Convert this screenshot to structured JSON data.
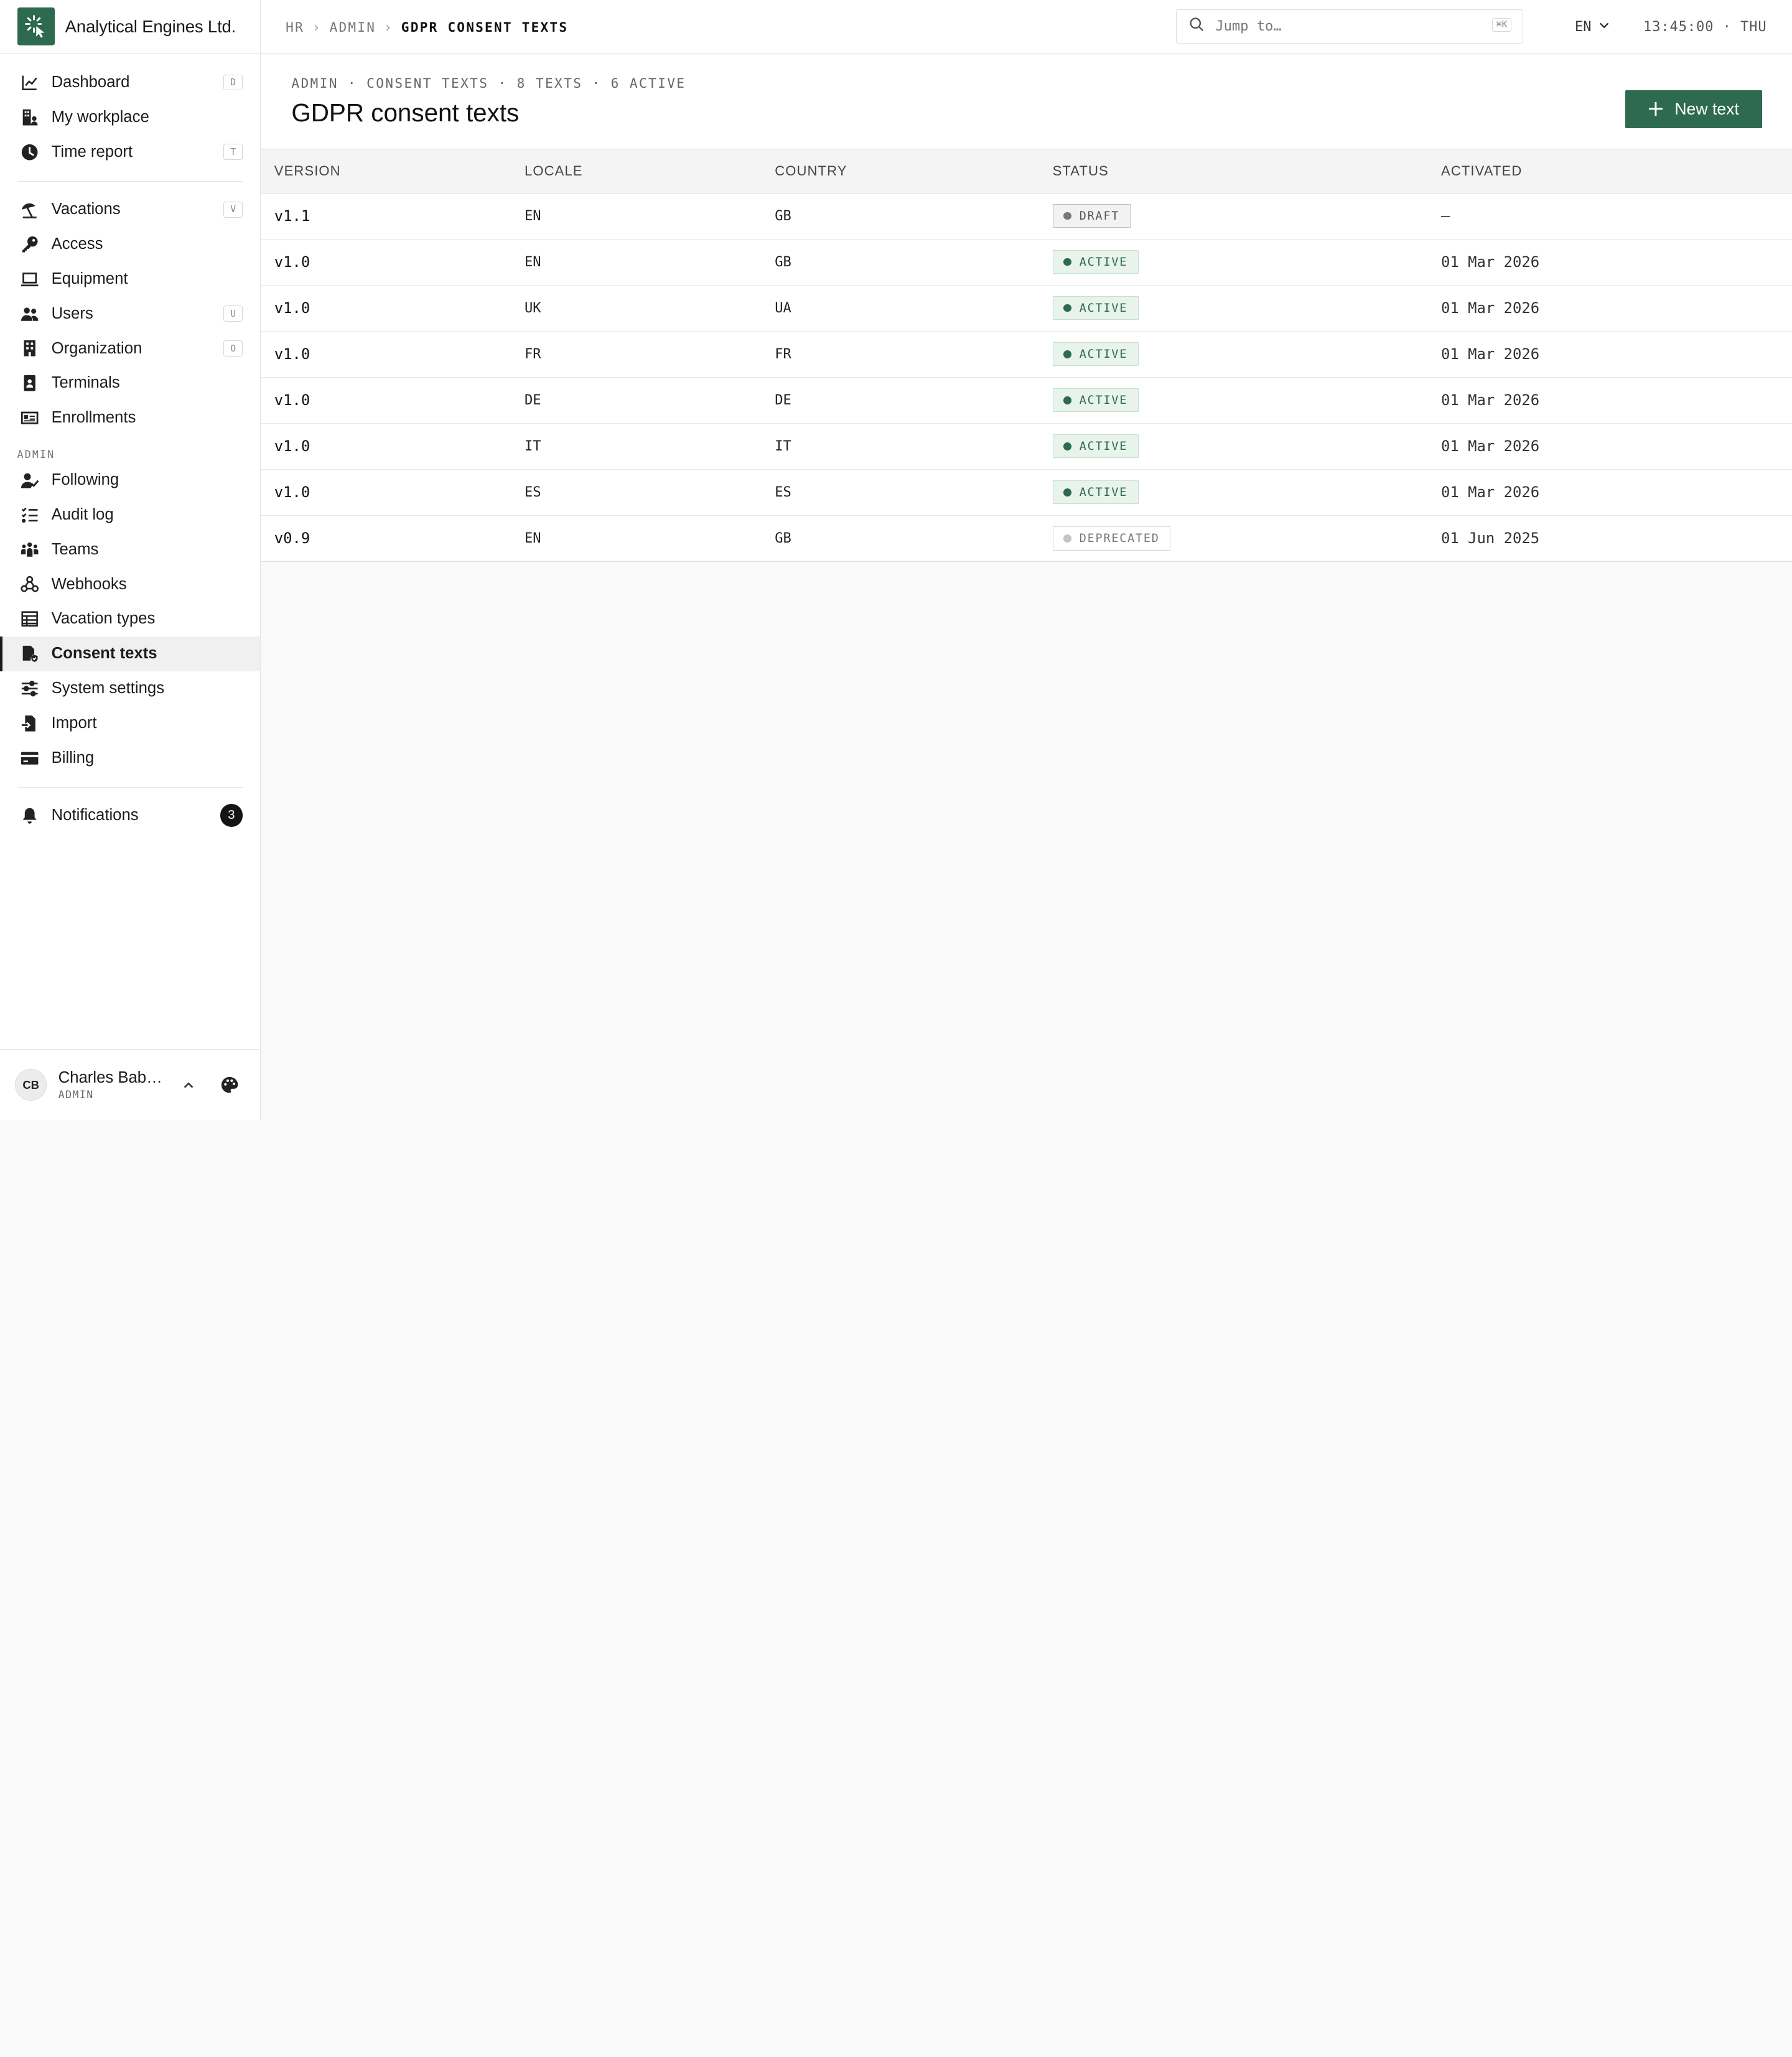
{
  "brand": {
    "name": "Analytical Engines Ltd.",
    "logo_icon": "sparkle-cursor-icon",
    "accent": "#2d6a4f"
  },
  "sidebar": {
    "items": [
      {
        "label": "Dashboard",
        "icon": "chart-line-icon",
        "shortcut": "D"
      },
      {
        "label": "My workplace",
        "icon": "building-user-icon",
        "shortcut": ""
      },
      {
        "label": "Time report",
        "icon": "clock-icon",
        "shortcut": "T"
      },
      {
        "label": "Vacations",
        "icon": "beach-umbrella-icon",
        "shortcut": "V"
      },
      {
        "label": "Access",
        "icon": "key-icon",
        "shortcut": ""
      },
      {
        "label": "Equipment",
        "icon": "laptop-icon",
        "shortcut": ""
      },
      {
        "label": "Users",
        "icon": "users-icon",
        "shortcut": "U"
      },
      {
        "label": "Organization",
        "icon": "office-building-icon",
        "shortcut": "O"
      },
      {
        "label": "Terminals",
        "icon": "terminal-badge-icon",
        "shortcut": ""
      },
      {
        "label": "Enrollments",
        "icon": "id-card-icon",
        "shortcut": ""
      }
    ],
    "admin_section_label": "ADMIN",
    "admin_items": [
      {
        "label": "Following",
        "icon": "user-check-icon"
      },
      {
        "label": "Audit log",
        "icon": "list-check-icon"
      },
      {
        "label": "Teams",
        "icon": "team-icon"
      },
      {
        "label": "Webhooks",
        "icon": "webhook-icon"
      },
      {
        "label": "Vacation types",
        "icon": "table-icon"
      },
      {
        "label": "Consent texts",
        "icon": "file-shield-icon",
        "active": true
      },
      {
        "label": "System settings",
        "icon": "sliders-icon"
      },
      {
        "label": "Import",
        "icon": "file-import-icon"
      },
      {
        "label": "Billing",
        "icon": "credit-card-icon"
      }
    ],
    "notifications": {
      "label": "Notifications",
      "icon": "bell-icon",
      "count": "3"
    },
    "user": {
      "initials": "CB",
      "name": "Charles Babbage",
      "name_display": "Charles Bab…",
      "role": "ADMIN"
    }
  },
  "topbar": {
    "breadcrumb": [
      "HR",
      "ADMIN",
      "GDPR CONSENT TEXTS"
    ],
    "search_placeholder": "Jump to…",
    "search_shortcut": "⌘K",
    "language": "EN",
    "clock": "13:45:00 · THU"
  },
  "page": {
    "meta": "ADMIN · CONSENT TEXTS · 8 TEXTS · 6 ACTIVE",
    "title": "GDPR consent texts",
    "new_button": "New text"
  },
  "table": {
    "columns": [
      "VERSION",
      "LOCALE",
      "COUNTRY",
      "STATUS",
      "ACTIVATED"
    ],
    "rows": [
      {
        "version": "v1.1",
        "locale": "EN",
        "country": "GB",
        "status": "DRAFT",
        "status_kind": "draft",
        "activated": "—"
      },
      {
        "version": "v1.0",
        "locale": "EN",
        "country": "GB",
        "status": "ACTIVE",
        "status_kind": "active",
        "activated": "01 Mar 2026"
      },
      {
        "version": "v1.0",
        "locale": "UK",
        "country": "UA",
        "status": "ACTIVE",
        "status_kind": "active",
        "activated": "01 Mar 2026"
      },
      {
        "version": "v1.0",
        "locale": "FR",
        "country": "FR",
        "status": "ACTIVE",
        "status_kind": "active",
        "activated": "01 Mar 2026"
      },
      {
        "version": "v1.0",
        "locale": "DE",
        "country": "DE",
        "status": "ACTIVE",
        "status_kind": "active",
        "activated": "01 Mar 2026"
      },
      {
        "version": "v1.0",
        "locale": "IT",
        "country": "IT",
        "status": "ACTIVE",
        "status_kind": "active",
        "activated": "01 Mar 2026"
      },
      {
        "version": "v1.0",
        "locale": "ES",
        "country": "ES",
        "status": "ACTIVE",
        "status_kind": "active",
        "activated": "01 Mar 2026"
      },
      {
        "version": "v0.9",
        "locale": "EN",
        "country": "GB",
        "status": "DEPRECATED",
        "status_kind": "deprecated",
        "activated": "01 Jun 2025"
      }
    ]
  }
}
